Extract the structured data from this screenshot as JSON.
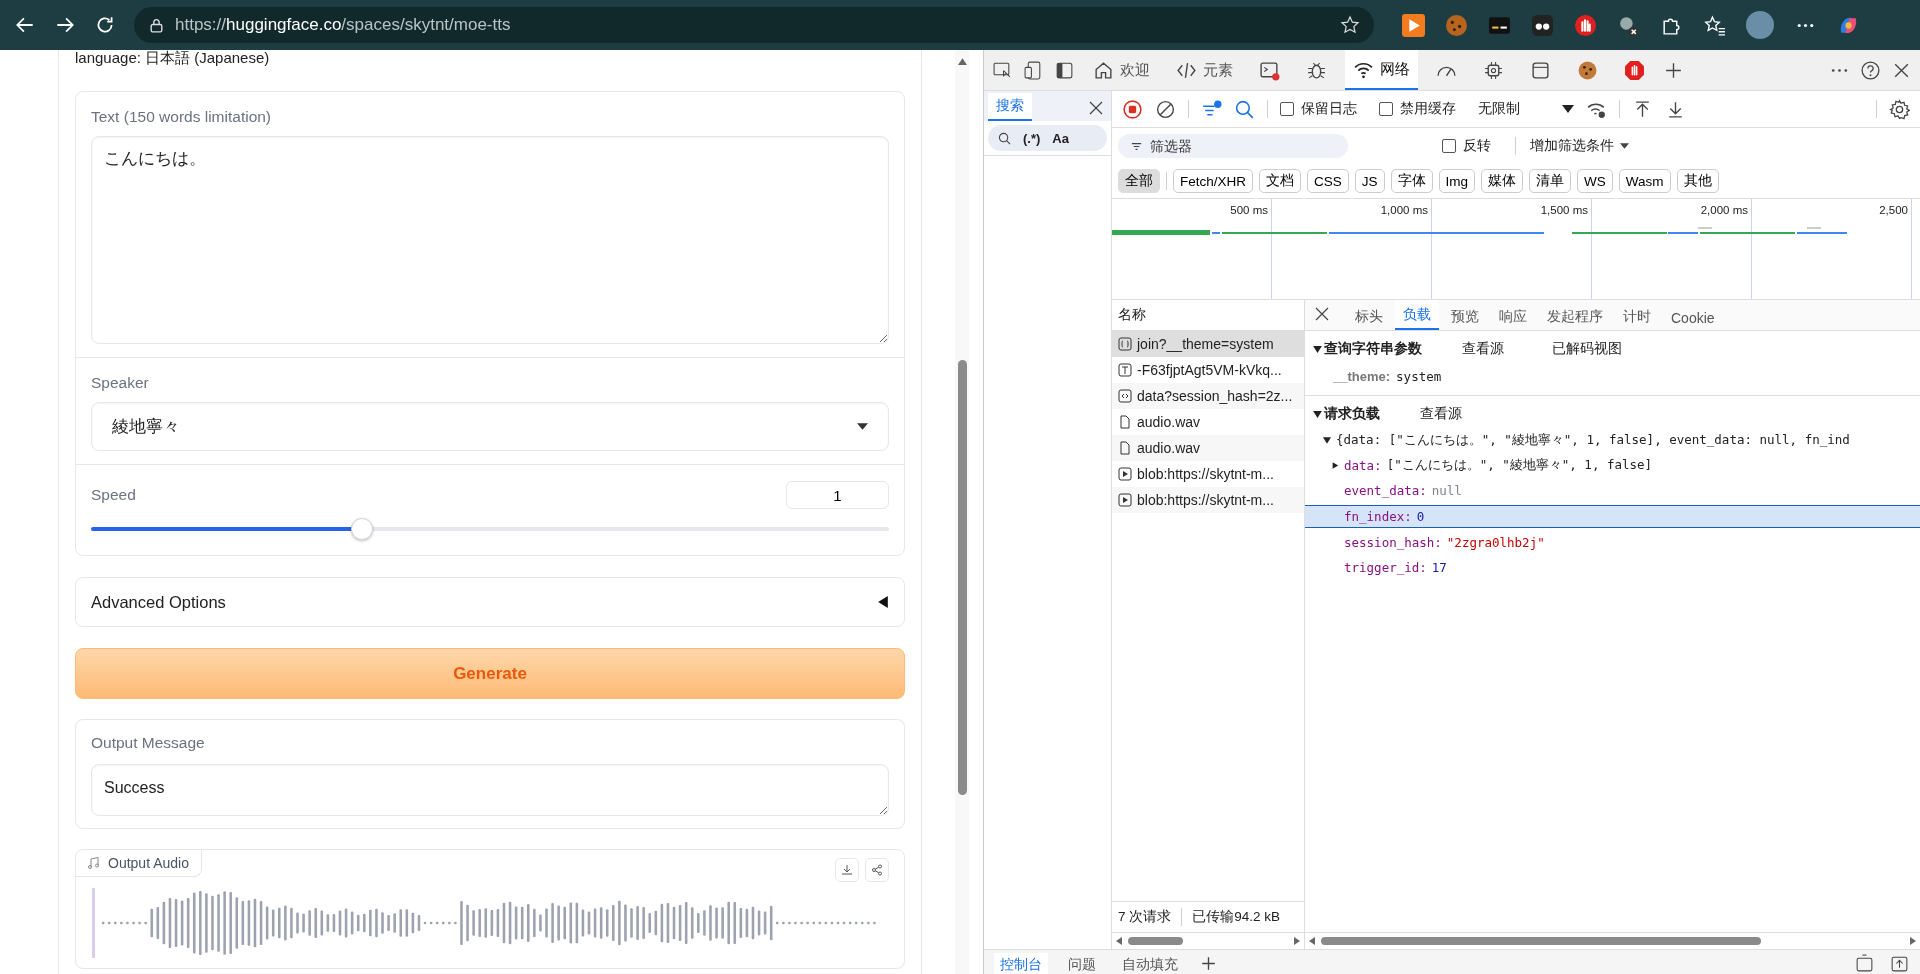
{
  "browser": {
    "url": "https://**huggingface.co**/spaces/skytnt/moe-tts"
  },
  "app": {
    "language_line": "language: 日本語 (Japanese)",
    "text_field": {
      "label": "Text (150 words limitation)",
      "value": "こんにちは。"
    },
    "speaker": {
      "label": "Speaker",
      "value": "綾地寧々"
    },
    "speed": {
      "label": "Speed",
      "value": "1",
      "level": 0.34
    },
    "advanced": {
      "label": "Advanced Options",
      "expanded": false
    },
    "generate": {
      "label": "Generate"
    },
    "output_message": {
      "label": "Output Message",
      "value": "Success"
    },
    "output_audio": {
      "label": "Output Audio"
    }
  },
  "devtools": {
    "tabs": [
      {
        "kind": "home",
        "label": "欢迎",
        "selected": false
      },
      {
        "kind": "code",
        "label": "元素",
        "selected": false
      },
      {
        "kind": "console",
        "selected": false
      },
      {
        "kind": "bug",
        "selected": false
      },
      {
        "kind": "wifi",
        "label": "网络",
        "selected": true
      },
      {
        "kind": "gauge",
        "selected": false
      },
      {
        "kind": "chip",
        "selected": false
      },
      {
        "kind": "window",
        "selected": false
      },
      {
        "kind": "cookie",
        "selected": false
      },
      {
        "kind": "stop",
        "selected": false
      }
    ],
    "search_panel": {
      "tab": "搜索",
      "regex": "(.*)",
      "case": "Aa"
    },
    "toolbar": {
      "recording": true,
      "checkboxes": [
        {
          "label": "保留日志",
          "checked": false
        },
        {
          "label": "禁用缓存",
          "checked": false
        }
      ],
      "throttle": "无限制"
    },
    "filter": {
      "placeholder": "筛选器",
      "invert": {
        "label": "反转",
        "checked": false
      },
      "more": "增加筛选条件"
    },
    "types": [
      {
        "label": "全部",
        "selected": true
      },
      {
        "label": "Fetch/XHR",
        "selected": false
      },
      {
        "label": "文档",
        "selected": false
      },
      {
        "label": "CSS",
        "selected": false
      },
      {
        "label": "JS",
        "selected": false
      },
      {
        "label": "字体",
        "selected": false
      },
      {
        "label": "Img",
        "selected": false
      },
      {
        "label": "媒体",
        "selected": false
      },
      {
        "label": "清单",
        "selected": false
      },
      {
        "label": "WS",
        "selected": false
      },
      {
        "label": "Wasm",
        "selected": false
      },
      {
        "label": "其他",
        "selected": false
      }
    ],
    "timeline": {
      "ticks": [
        "500 ms",
        "1,000 ms",
        "1,500 ms",
        "2,000 ms",
        "2,500"
      ]
    },
    "requests": {
      "header": "名称",
      "rows": [
        {
          "kind": "json",
          "name": "join?__theme=system",
          "selected": true
        },
        {
          "kind": "text",
          "name": "-F63fjptAgt5VM-kVkq...",
          "selected": false
        },
        {
          "kind": "code",
          "name": "data?session_hash=2z...",
          "selected": false
        },
        {
          "kind": "file",
          "name": "audio.wav",
          "selected": false
        },
        {
          "kind": "file",
          "name": "audio.wav",
          "selected": false
        },
        {
          "kind": "media",
          "name": "blob:https://skytnt-m...",
          "selected": false
        },
        {
          "kind": "media",
          "name": "blob:https://skytnt-m...",
          "selected": false
        }
      ]
    },
    "details": {
      "tabs": [
        {
          "label": "标头",
          "selected": false
        },
        {
          "label": "负载",
          "selected": true
        },
        {
          "label": "预览",
          "selected": false
        },
        {
          "label": "响应",
          "selected": false
        },
        {
          "label": "发起程序",
          "selected": false
        },
        {
          "label": "计时",
          "selected": false
        },
        {
          "label": "Cookie",
          "selected": false
        }
      ],
      "query": {
        "title": "查询字符串参数",
        "links": [
          "查看源",
          "已解码视图"
        ],
        "params": [
          {
            "key": "__theme:",
            "value": "system"
          }
        ]
      },
      "payload": {
        "title": "请求负载",
        "links": [
          "查看源"
        ],
        "summary": "{data: [\"こんにちは。\", \"綾地寧々\", 1, false], event_data: null, fn_ind",
        "expanded": true,
        "fields": [
          {
            "key": "data:",
            "value": "[\"こんにちは。\", \"綾地寧々\", 1, false]",
            "kind": "array",
            "expanded": false,
            "selected": false
          },
          {
            "key": "event_data:",
            "value": "null",
            "kind": "null",
            "selected": false
          },
          {
            "key": "fn_index:",
            "value": "0",
            "kind": "number",
            "selected": true
          },
          {
            "key": "session_hash:",
            "value": "\"2zgra0lhb2j\"",
            "kind": "string",
            "selected": false
          },
          {
            "key": "trigger_id:",
            "value": "17",
            "kind": "number",
            "selected": false
          }
        ]
      }
    },
    "status": {
      "requests": "7 次请求",
      "transferred": "已传输94.2 kB"
    },
    "drawer": {
      "tabs": [
        {
          "label": "控制台",
          "selected": true
        },
        {
          "label": "问题",
          "selected": false
        },
        {
          "label": "自动填充",
          "selected": false
        }
      ]
    }
  }
}
